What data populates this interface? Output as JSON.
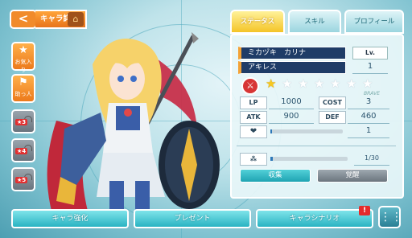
{
  "header": {
    "back_glyph": "<",
    "title": "キャラ詳細",
    "home_icon": "home-icon"
  },
  "side": {
    "favorite": "お気入り",
    "leader": "助っ人",
    "slots": [
      "★3",
      "★4",
      "★5"
    ]
  },
  "tabs": [
    {
      "label": "ステータス",
      "active": true
    },
    {
      "label": "スキル",
      "active": false
    },
    {
      "label": "プロフィール",
      "active": false
    }
  ],
  "status": {
    "name": "ミカヅキ　カリナ",
    "level_label": "Lv.",
    "level_value": "",
    "class": "アキレス",
    "class_value": "1",
    "stars_total": 7,
    "stars_filled": 1,
    "type_tag": "BRAVE",
    "lp_label": "LP",
    "lp_value": "1000",
    "cost_label": "COST",
    "cost_value": "3",
    "atk_label": "ATK",
    "atk_value": "900",
    "def_label": "DEF",
    "def_value": "460",
    "affection_value": "1",
    "affection_fill": 0.02,
    "collect_value": "1/30",
    "collect_fill": 0.0333,
    "collect_button": "収集",
    "awaken_button": "覚醒"
  },
  "bottom": {
    "enhance": "キャラ強化",
    "present": "プレゼント",
    "scenario": "キャラシナリオ",
    "notice": "!"
  },
  "colors": {
    "accent_orange": "#f18b2b",
    "teal": "#2ab3c2",
    "navy": "#1f3c67"
  }
}
